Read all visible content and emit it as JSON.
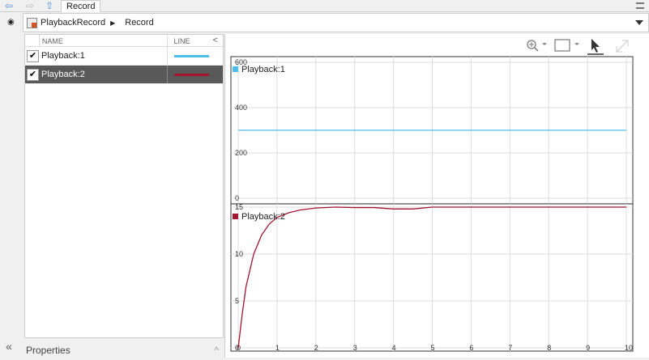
{
  "nav": {
    "back_icon": "arrow-left-icon",
    "forward_icon": "arrow-right-icon",
    "up_icon": "arrow-up-icon",
    "tab": "Record"
  },
  "breadcrumb": {
    "root": "PlaybackRecord",
    "child": "Record"
  },
  "list": {
    "headers": {
      "name": "NAME",
      "line": "LINE",
      "collapse": "<"
    },
    "rows": [
      {
        "name": "Playback:1",
        "checked": true,
        "color": "#4dbeee",
        "selected": false
      },
      {
        "name": "Playback:2",
        "checked": true,
        "color": "#a2142f",
        "selected": true
      }
    ]
  },
  "properties": {
    "label": "Properties",
    "expand": "«",
    "collapse": "^"
  },
  "toolbar": {
    "zoom": "zoom-in-icon",
    "fit": "fit-to-view-icon",
    "cursor": "cursor-icon",
    "expand": "maximize-icon"
  },
  "chart_data": [
    {
      "type": "line",
      "legend": "Playback:1",
      "color": "#4dbeee",
      "ylim": [
        -10,
        610
      ],
      "yticks": [
        0,
        200,
        400,
        600
      ],
      "xlim": [
        0,
        10
      ],
      "grid": true,
      "x": [
        0,
        10
      ],
      "y": [
        300,
        300
      ]
    },
    {
      "type": "line",
      "legend": "Playback:2",
      "color": "#a2142f",
      "ylim": [
        0,
        15.6
      ],
      "yticks": [
        0,
        5,
        10,
        15
      ],
      "xlim": [
        0,
        10
      ],
      "xticks": [
        0,
        1,
        2,
        3,
        4,
        5,
        6,
        7,
        8,
        9,
        10
      ],
      "grid": true,
      "x": [
        0,
        0.1,
        0.2,
        0.4,
        0.6,
        0.8,
        1.0,
        1.3,
        1.6,
        2.0,
        2.5,
        3.0,
        3.5,
        4.0,
        4.5,
        5.0,
        5.5,
        6.0,
        7.0,
        8.0,
        9.0,
        10.0
      ],
      "y": [
        0,
        3.5,
        6.5,
        10,
        12,
        13.2,
        13.9,
        14.4,
        14.7,
        14.9,
        15.0,
        14.95,
        14.95,
        14.8,
        14.8,
        15.0,
        15.0,
        15.0,
        15.0,
        15.0,
        15.0,
        15.0
      ]
    }
  ]
}
